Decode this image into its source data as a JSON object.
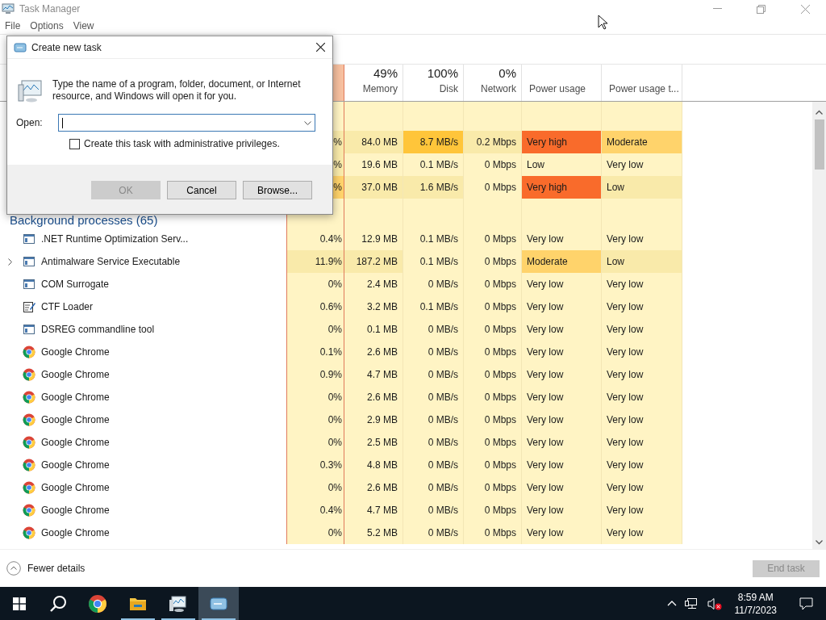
{
  "window": {
    "title": "Task Manager"
  },
  "menu": [
    "File",
    "Options",
    "View"
  ],
  "columns": [
    {
      "kind": "cpu"
    },
    {
      "kind": "num",
      "percent": "49%",
      "label": "Memory"
    },
    {
      "kind": "num",
      "percent": "100%",
      "label": "Disk"
    },
    {
      "kind": "num",
      "percent": "0%",
      "label": "Network"
    },
    {
      "kind": "text",
      "label": "Power usage"
    },
    {
      "kind": "text",
      "label": "Power usage t..."
    }
  ],
  "rows": [
    {
      "kind": "group"
    },
    {
      "kind": "covered",
      "cells": [
        {
          "text": "%",
          "color": "#f9eaaa"
        },
        {
          "text": "84.0 MB",
          "color": "#f9eaaa"
        },
        {
          "text": "8.7 MB/s",
          "color": "#ffc53a"
        },
        {
          "text": "0.2 Mbps",
          "color": "#f9eaaa"
        },
        {
          "text": "Very high",
          "color": "#f96b2b"
        },
        {
          "text": "Moderate",
          "color": "#ffd36b"
        }
      ]
    },
    {
      "kind": "covered",
      "cells": [
        {
          "text": "%",
          "color": "#f9eaaa"
        },
        {
          "text": "19.6 MB",
          "color": "#fff4c4"
        },
        {
          "text": "0.1 MB/s",
          "color": "#fff4c4"
        },
        {
          "text": "0 Mbps",
          "color": "#fff4c4"
        },
        {
          "text": "Low",
          "color": "#fff4c4"
        },
        {
          "text": "Very low",
          "color": "#fff4c4"
        }
      ]
    },
    {
      "kind": "covered",
      "cells": [
        {
          "text": "%",
          "color": "#ffd36b"
        },
        {
          "text": "37.0 MB",
          "color": "#f9eaaa"
        },
        {
          "text": "1.6 MB/s",
          "color": "#f9eaaa"
        },
        {
          "text": "0 Mbps",
          "color": "#fff4c4"
        },
        {
          "text": "Very high",
          "color": "#f96b2b"
        },
        {
          "text": "Low",
          "color": "#f9eaaa"
        }
      ]
    },
    {
      "kind": "group",
      "title": "Background processes (65)"
    },
    {
      "kind": "window",
      "name": ".NET Runtime Optimization Serv...",
      "cells": [
        {
          "text": "0.4%",
          "color": "#fff4c4"
        },
        {
          "text": "12.9 MB",
          "color": "#fff4c4"
        },
        {
          "text": "0.1 MB/s",
          "color": "#fff4c4"
        },
        {
          "text": "0 Mbps",
          "color": "#fff4c4"
        },
        {
          "text": "Very low",
          "color": "#fff4c4"
        },
        {
          "text": "Very low",
          "color": "#fff4c4"
        }
      ]
    },
    {
      "kind": "window",
      "expandable": true,
      "name": "Antimalware Service Executable",
      "cells": [
        {
          "text": "11.9%",
          "color": "#f9eaaa"
        },
        {
          "text": "187.2 MB",
          "color": "#f9eaaa"
        },
        {
          "text": "0.1 MB/s",
          "color": "#fff4c4"
        },
        {
          "text": "0 Mbps",
          "color": "#fff4c4"
        },
        {
          "text": "Moderate",
          "color": "#ffd36b"
        },
        {
          "text": "Low",
          "color": "#f9eaaa"
        }
      ]
    },
    {
      "kind": "window",
      "name": "COM Surrogate",
      "cells": [
        {
          "text": "0%",
          "color": "#fff4c4"
        },
        {
          "text": "2.4 MB",
          "color": "#fff4c4"
        },
        {
          "text": "0 MB/s",
          "color": "#fff4c4"
        },
        {
          "text": "0 Mbps",
          "color": "#fff4c4"
        },
        {
          "text": "Very low",
          "color": "#fff4c4"
        },
        {
          "text": "Very low",
          "color": "#fff4c4"
        }
      ]
    },
    {
      "kind": "notepad",
      "name": "CTF Loader",
      "cells": [
        {
          "text": "0.6%",
          "color": "#fff4c4"
        },
        {
          "text": "3.2 MB",
          "color": "#fff4c4"
        },
        {
          "text": "0.1 MB/s",
          "color": "#fff4c4"
        },
        {
          "text": "0 Mbps",
          "color": "#fff4c4"
        },
        {
          "text": "Very low",
          "color": "#fff4c4"
        },
        {
          "text": "Very low",
          "color": "#fff4c4"
        }
      ]
    },
    {
      "kind": "window",
      "name": "DSREG commandline tool",
      "cells": [
        {
          "text": "0%",
          "color": "#fff4c4"
        },
        {
          "text": "0.1 MB",
          "color": "#fff4c4"
        },
        {
          "text": "0 MB/s",
          "color": "#fff4c4"
        },
        {
          "text": "0 Mbps",
          "color": "#fff4c4"
        },
        {
          "text": "Very low",
          "color": "#fff4c4"
        },
        {
          "text": "Very low",
          "color": "#fff4c4"
        }
      ]
    },
    {
      "kind": "chrome",
      "name": "Google Chrome",
      "cells": [
        {
          "text": "0.1%",
          "color": "#fff4c4"
        },
        {
          "text": "2.6 MB",
          "color": "#fff4c4"
        },
        {
          "text": "0 MB/s",
          "color": "#fff4c4"
        },
        {
          "text": "0 Mbps",
          "color": "#fff4c4"
        },
        {
          "text": "Very low",
          "color": "#fff4c4"
        },
        {
          "text": "Very low",
          "color": "#fff4c4"
        }
      ]
    },
    {
      "kind": "chrome",
      "name": "Google Chrome",
      "cells": [
        {
          "text": "0.9%",
          "color": "#fff4c4"
        },
        {
          "text": "4.7 MB",
          "color": "#fff4c4"
        },
        {
          "text": "0 MB/s",
          "color": "#fff4c4"
        },
        {
          "text": "0 Mbps",
          "color": "#fff4c4"
        },
        {
          "text": "Very low",
          "color": "#fff4c4"
        },
        {
          "text": "Very low",
          "color": "#fff4c4"
        }
      ]
    },
    {
      "kind": "chrome",
      "name": "Google Chrome",
      "cells": [
        {
          "text": "0%",
          "color": "#fff4c4"
        },
        {
          "text": "2.6 MB",
          "color": "#fff4c4"
        },
        {
          "text": "0 MB/s",
          "color": "#fff4c4"
        },
        {
          "text": "0 Mbps",
          "color": "#fff4c4"
        },
        {
          "text": "Very low",
          "color": "#fff4c4"
        },
        {
          "text": "Very low",
          "color": "#fff4c4"
        }
      ]
    },
    {
      "kind": "chrome",
      "name": "Google Chrome",
      "cells": [
        {
          "text": "0%",
          "color": "#fff4c4"
        },
        {
          "text": "2.9 MB",
          "color": "#fff4c4"
        },
        {
          "text": "0 MB/s",
          "color": "#fff4c4"
        },
        {
          "text": "0 Mbps",
          "color": "#fff4c4"
        },
        {
          "text": "Very low",
          "color": "#fff4c4"
        },
        {
          "text": "Very low",
          "color": "#fff4c4"
        }
      ]
    },
    {
      "kind": "chrome",
      "name": "Google Chrome",
      "cells": [
        {
          "text": "0%",
          "color": "#fff4c4"
        },
        {
          "text": "2.5 MB",
          "color": "#fff4c4"
        },
        {
          "text": "0 MB/s",
          "color": "#fff4c4"
        },
        {
          "text": "0 Mbps",
          "color": "#fff4c4"
        },
        {
          "text": "Very low",
          "color": "#fff4c4"
        },
        {
          "text": "Very low",
          "color": "#fff4c4"
        }
      ]
    },
    {
      "kind": "chrome",
      "name": "Google Chrome",
      "cells": [
        {
          "text": "0.3%",
          "color": "#fff4c4"
        },
        {
          "text": "4.8 MB",
          "color": "#fff4c4"
        },
        {
          "text": "0 MB/s",
          "color": "#fff4c4"
        },
        {
          "text": "0 Mbps",
          "color": "#fff4c4"
        },
        {
          "text": "Very low",
          "color": "#fff4c4"
        },
        {
          "text": "Very low",
          "color": "#fff4c4"
        }
      ]
    },
    {
      "kind": "chrome",
      "name": "Google Chrome",
      "cells": [
        {
          "text": "0%",
          "color": "#fff4c4"
        },
        {
          "text": "2.6 MB",
          "color": "#fff4c4"
        },
        {
          "text": "0 MB/s",
          "color": "#fff4c4"
        },
        {
          "text": "0 Mbps",
          "color": "#fff4c4"
        },
        {
          "text": "Very low",
          "color": "#fff4c4"
        },
        {
          "text": "Very low",
          "color": "#fff4c4"
        }
      ]
    },
    {
      "kind": "chrome",
      "name": "Google Chrome",
      "cells": [
        {
          "text": "0.4%",
          "color": "#fff4c4"
        },
        {
          "text": "4.7 MB",
          "color": "#fff4c4"
        },
        {
          "text": "0 MB/s",
          "color": "#fff4c4"
        },
        {
          "text": "0 Mbps",
          "color": "#fff4c4"
        },
        {
          "text": "Very low",
          "color": "#fff4c4"
        },
        {
          "text": "Very low",
          "color": "#fff4c4"
        }
      ]
    },
    {
      "kind": "chrome",
      "name": "Google Chrome",
      "cells": [
        {
          "text": "0%",
          "color": "#fff4c4"
        },
        {
          "text": "5.2 MB",
          "color": "#fff4c4"
        },
        {
          "text": "0 MB/s",
          "color": "#fff4c4"
        },
        {
          "text": "0 Mbps",
          "color": "#fff4c4"
        },
        {
          "text": "Very low",
          "color": "#fff4c4"
        },
        {
          "text": "Very low",
          "color": "#fff4c4"
        }
      ]
    }
  ],
  "footer": {
    "fewer_details": "Fewer details",
    "end_task": {
      "label": "End task",
      "disabled": true
    }
  },
  "dialog": {
    "title": "Create new task",
    "message": "Type the name of a program, folder, document, or Internet resource, and Windows will open it for you.",
    "open_label": "Open:",
    "admin_checkbox": {
      "label": "Create this task with administrative privileges.",
      "checked": false
    },
    "buttons": [
      {
        "label": "OK",
        "disabled": true
      },
      {
        "label": "Cancel",
        "disabled": false
      },
      {
        "label": "Browse...",
        "disabled": false
      }
    ]
  },
  "taskbar": {
    "apps": [
      {
        "kind": "chrome",
        "running": false,
        "selected": false
      },
      {
        "kind": "folder",
        "running": true,
        "selected": false
      },
      {
        "kind": "monitor",
        "running": true,
        "selected": false
      },
      {
        "kind": "run",
        "running": true,
        "selected": true
      }
    ],
    "time": "8:59 AM",
    "date": "11/7/2023"
  }
}
